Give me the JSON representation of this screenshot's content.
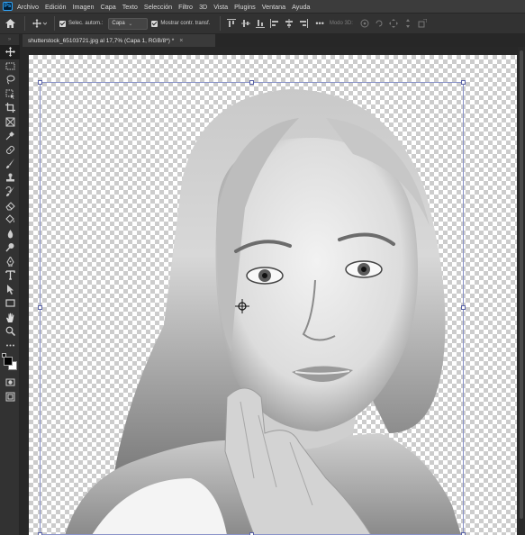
{
  "app": {
    "logo": "Ps"
  },
  "menu": {
    "items": [
      "Archivo",
      "Edición",
      "Imagen",
      "Capa",
      "Texto",
      "Selección",
      "Filtro",
      "3D",
      "Vista",
      "Plugins",
      "Ventana",
      "Ayuda"
    ]
  },
  "options_bar": {
    "auto_select_label": "Selec. autom.:",
    "layer_dropdown": "Capa",
    "show_transform_label": "Mostrar contr. transf.",
    "more": "•••",
    "mode3d_label": "Modo 3D:"
  },
  "document_tab": {
    "title": "shutterstock_65103721.jpg al 17,7% (Capa 1, RGB/8*) *",
    "close": "×"
  },
  "tools": [
    {
      "name": "move-tool-icon",
      "active": true
    },
    {
      "name": "marquee-tool-icon"
    },
    {
      "name": "lasso-tool-icon"
    },
    {
      "name": "object-select-tool-icon"
    },
    {
      "name": "crop-tool-icon"
    },
    {
      "name": "frame-tool-icon"
    },
    {
      "name": "eyedropper-tool-icon"
    },
    {
      "name": "healing-brush-tool-icon"
    },
    {
      "name": "brush-tool-icon"
    },
    {
      "name": "clone-stamp-tool-icon"
    },
    {
      "name": "history-brush-tool-icon"
    },
    {
      "name": "eraser-tool-icon"
    },
    {
      "name": "paint-bucket-tool-icon"
    },
    {
      "name": "blur-tool-icon"
    },
    {
      "name": "dodge-tool-icon"
    },
    {
      "name": "pen-tool-icon"
    },
    {
      "name": "type-tool-icon"
    },
    {
      "name": "path-select-tool-icon"
    },
    {
      "name": "rectangle-tool-icon"
    },
    {
      "name": "hand-tool-icon"
    },
    {
      "name": "zoom-tool-icon"
    },
    {
      "name": "more-tools-icon"
    }
  ],
  "colors": {
    "foreground": "#000000",
    "background": "#ffffff",
    "selection_border": "#8a93c9"
  }
}
